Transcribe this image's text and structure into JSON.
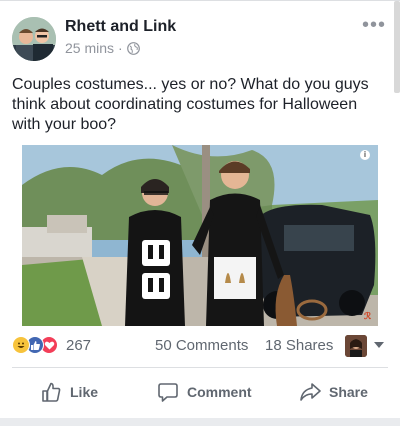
{
  "post": {
    "author": "Rhett and Link",
    "time": "25 mins",
    "separator": "·",
    "more_glyph": "•••",
    "text": "Couples costumes... yes or no? What do you guys think about coordinating costumes for Halloween with your boo?",
    "video": {
      "info_glyph": "i"
    }
  },
  "stats": {
    "reaction_icons": [
      "haha-icon",
      "like-icon",
      "love-icon"
    ],
    "reaction_count": "267",
    "comments": "50 Comments",
    "shares": "18 Shares"
  },
  "actions": {
    "like_label": "Like",
    "comment_label": "Comment",
    "share_label": "Share"
  },
  "colors": {
    "brand_blue": "#4267b2",
    "love_red": "#f33e58",
    "haha_yellow": "#f7c33c",
    "text_gray": "#606770"
  }
}
